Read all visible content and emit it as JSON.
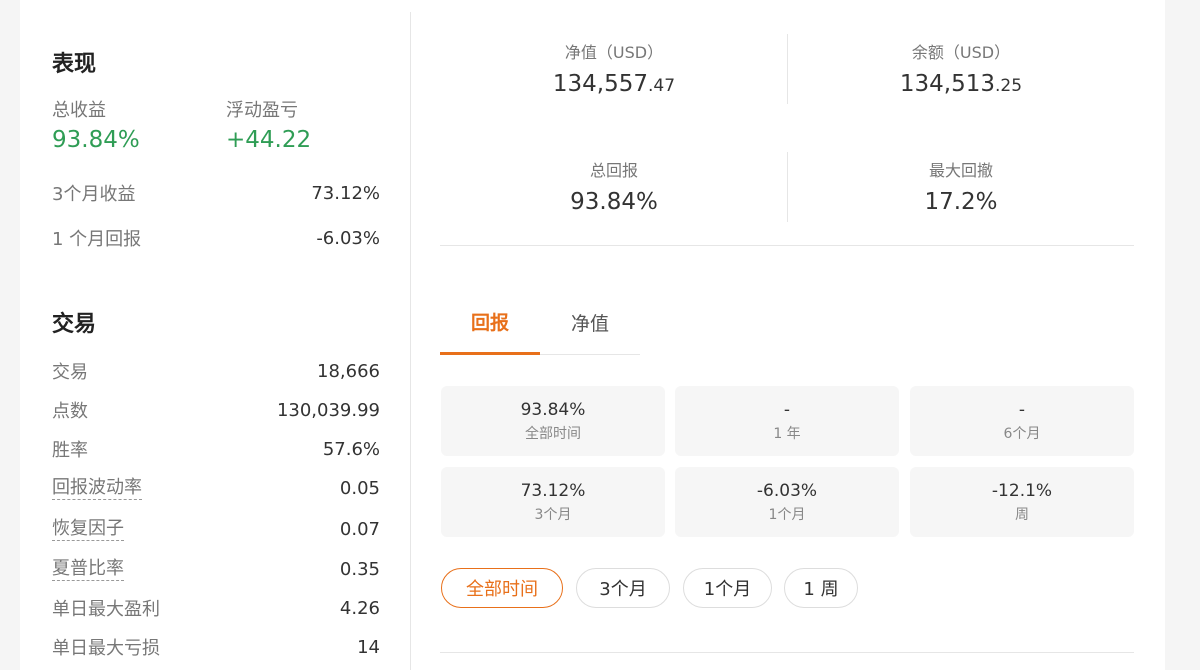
{
  "performance": {
    "title": "表现",
    "total_return_label": "总收益",
    "total_return_value": "93.84%",
    "floating_pnl_label": "浮动盈亏",
    "floating_pnl_value": "+44.22",
    "rows": [
      {
        "label": "3个月收益",
        "value": "73.12%"
      },
      {
        "label": "1 个月回报",
        "value": "-6.03%"
      }
    ]
  },
  "trading": {
    "title": "交易",
    "rows": [
      {
        "label": "交易",
        "value": "18,666"
      },
      {
        "label": "点数",
        "value": "130,039.99"
      },
      {
        "label": "胜率",
        "value": "57.6%"
      },
      {
        "label": "回报波动率",
        "value": "0.05"
      },
      {
        "label": "恢复因子",
        "value": "0.07"
      },
      {
        "label": "夏普比率",
        "value": "0.35"
      },
      {
        "label": "单日最大盈利",
        "value": "4.26"
      },
      {
        "label": "单日最大亏损",
        "value": "14"
      }
    ]
  },
  "summary": {
    "net_value": {
      "label": "净值（USD）",
      "int": "134,557",
      "dec": ".47"
    },
    "balance": {
      "label": "余额（USD）",
      "int": "134,513",
      "dec": ".25"
    },
    "total_return": {
      "label": "总回报",
      "value": "93.84%"
    },
    "max_drawdown": {
      "label": "最大回撤",
      "value": "17.2%"
    }
  },
  "tabs": [
    {
      "label": "回报",
      "active": true
    },
    {
      "label": "净值",
      "active": false
    }
  ],
  "returns_grid": [
    {
      "value": "93.84%",
      "period": "全部时间"
    },
    {
      "value": "-",
      "period": "1 年"
    },
    {
      "value": "-",
      "period": "6个月"
    },
    {
      "value": "73.12%",
      "period": "3个月"
    },
    {
      "value": "-6.03%",
      "period": "1个月"
    },
    {
      "value": "-12.1%",
      "period": "周"
    }
  ],
  "range_buttons": [
    {
      "label": "全部时间",
      "active": true
    },
    {
      "label": "3个月",
      "active": false
    },
    {
      "label": "1个月",
      "active": false
    },
    {
      "label": "1 周",
      "active": false
    }
  ],
  "colors": {
    "accent": "#e8701a",
    "positive": "#2f9d55"
  }
}
